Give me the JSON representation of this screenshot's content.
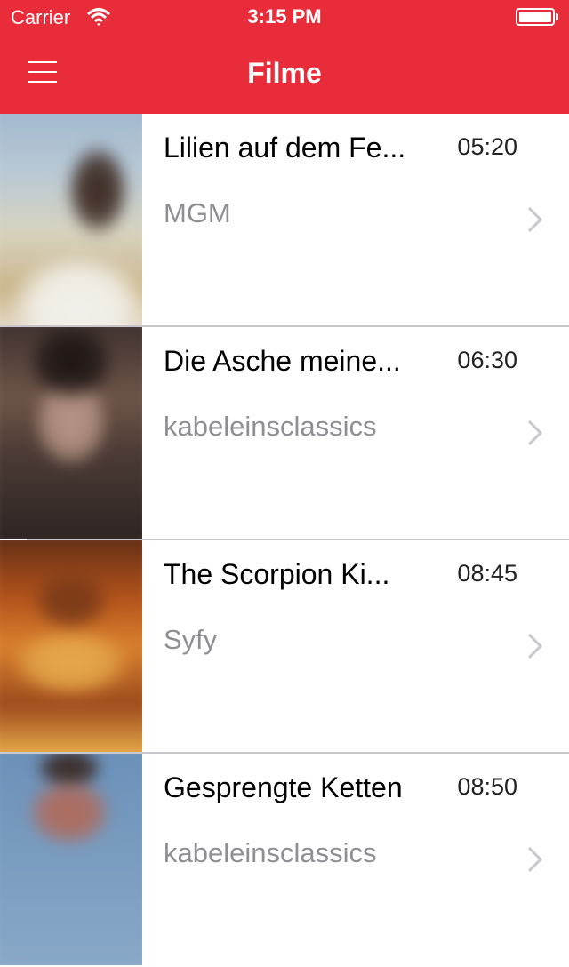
{
  "status_bar": {
    "carrier": "Carrier",
    "time": "3:15 PM"
  },
  "nav": {
    "title": "Filme",
    "menu_icon": "hamburger-menu-icon"
  },
  "colors": {
    "accent": "#e92c3a",
    "separator": "#c8c7cc",
    "secondary_text": "#8e8e93"
  },
  "movies": [
    {
      "title": "Lilien auf dem Fe...",
      "time": "05:20",
      "channel": "MGM"
    },
    {
      "title": "Die Asche meine...",
      "time": "06:30",
      "channel": "kabeleinsclassics"
    },
    {
      "title": "The Scorpion Ki...",
      "time": "08:45",
      "channel": "Syfy"
    },
    {
      "title": "Gesprengte Ketten",
      "time": "08:50",
      "channel": "kabeleinsclassics"
    }
  ]
}
